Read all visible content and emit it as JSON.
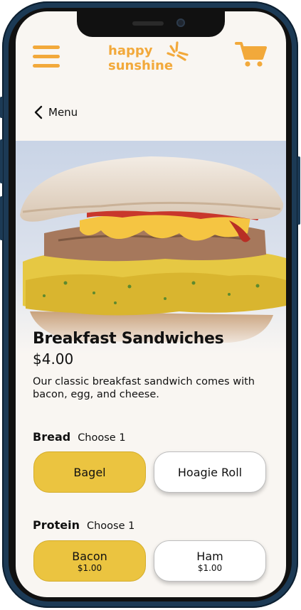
{
  "header": {
    "logo_line1": "happy",
    "logo_line2": "sunshine",
    "brand_color": "#f2a93b"
  },
  "nav": {
    "back_label": "Menu"
  },
  "product": {
    "title": "Breakfast Sandwiches",
    "price": "$4.00",
    "description": "Our classic breakfast sandwich comes with bacon, egg, and cheese."
  },
  "bread": {
    "title": "Bread",
    "subtitle": "Choose 1",
    "options": [
      {
        "label": "Bagel",
        "selected": true
      },
      {
        "label": "Hoagie Roll",
        "selected": false
      }
    ]
  },
  "protein": {
    "title": "Protein",
    "subtitle": "Choose 1",
    "options": [
      {
        "label": "Bacon",
        "price": "$1.00",
        "selected": true
      },
      {
        "label": "Ham",
        "price": "$1.00",
        "selected": false
      }
    ]
  },
  "colors": {
    "selected_option": "#ebc440",
    "background": "#f9f6f2",
    "frame": "#1c3a55"
  }
}
